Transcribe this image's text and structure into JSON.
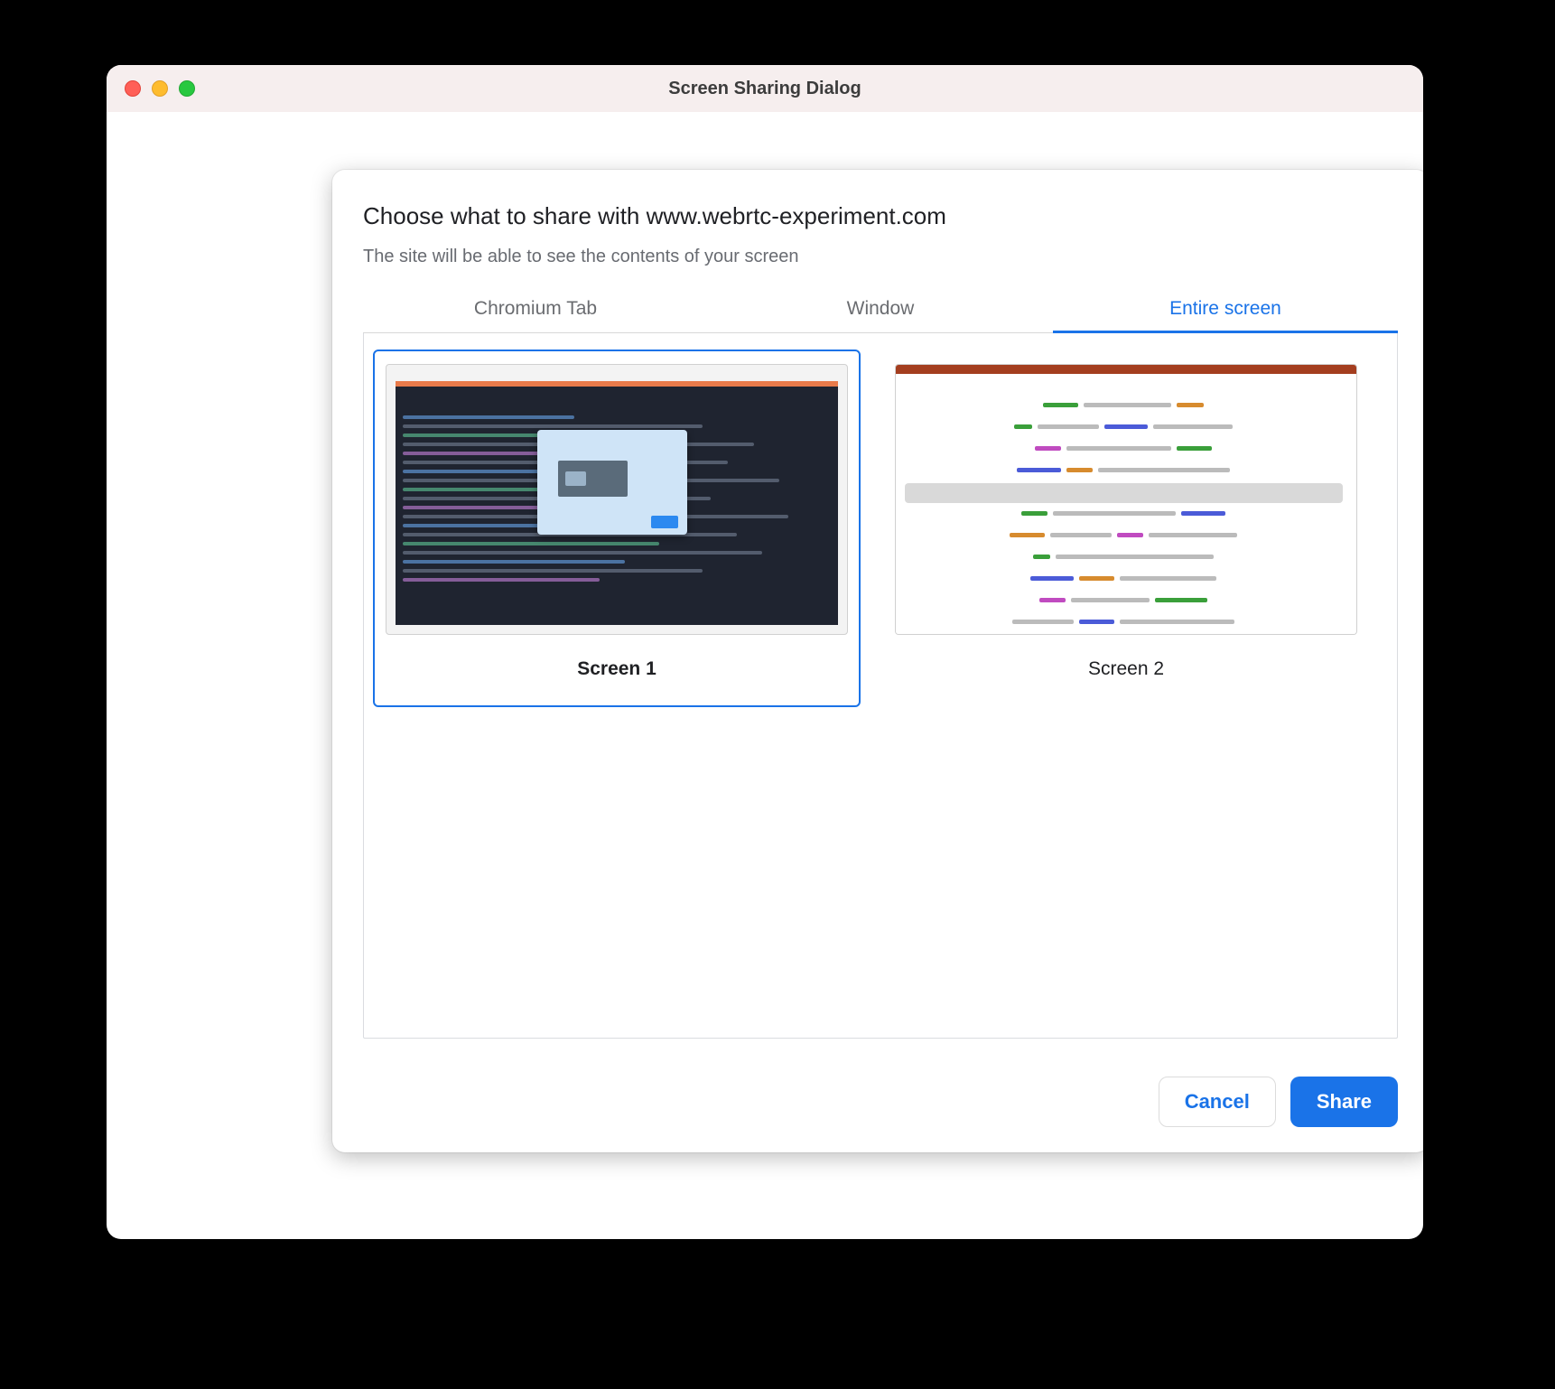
{
  "window": {
    "title": "Screen Sharing Dialog"
  },
  "dialog": {
    "title": "Choose what to share with www.webrtc-experiment.com",
    "subtitle": "The site will be able to see the contents of your screen",
    "tabs": {
      "chromium_tab": "Chromium Tab",
      "window": "Window",
      "entire_screen": "Entire screen",
      "active": "entire_screen"
    },
    "screens": [
      {
        "label": "Screen 1",
        "selected": true
      },
      {
        "label": "Screen 2",
        "selected": false
      }
    ],
    "cancel_label": "Cancel",
    "share_label": "Share"
  },
  "colors": {
    "accent": "#1a73e8"
  }
}
